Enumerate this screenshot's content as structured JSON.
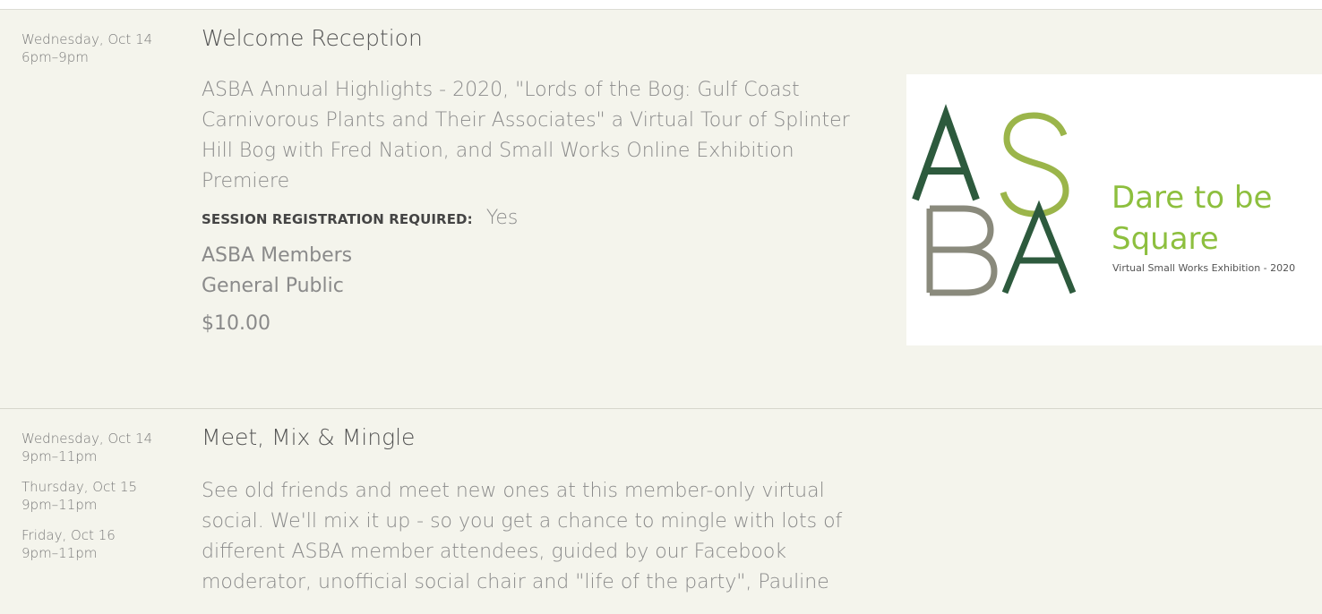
{
  "sessions": [
    {
      "dates": [
        {
          "day": "Wednesday, Oct 14",
          "time": "6pm–9pm"
        }
      ],
      "title": "Welcome Reception",
      "description": "ASBA Annual Highlights - 2020, \"Lords of the Bog: Gulf Coast Carnivorous Plants and Their Associates\" a Virtual Tour of Splinter Hill Bog with Fred Nation, and Small Works Online Exhibition Premiere",
      "registration_label": "SESSION REGISTRATION REQUIRED:",
      "registration_value": "Yes",
      "audience": [
        "ASBA Members",
        "General Public"
      ],
      "price": "$10.00",
      "image": {
        "logo_letters": [
          "A",
          "S",
          "B",
          "A"
        ],
        "headline": "Dare to be Square",
        "subtitle": "Virtual Small Works Exhibition - 2020",
        "colors": {
          "dark_green": "#2d5a3d",
          "light_green": "#9bb54a",
          "gray": "#8a8a7c",
          "headline": "#8dbf3e"
        }
      }
    },
    {
      "dates": [
        {
          "day": "Wednesday, Oct 14",
          "time": "9pm–11pm"
        },
        {
          "day": "Thursday, Oct 15",
          "time": "9pm–11pm"
        },
        {
          "day": "Friday, Oct 16",
          "time": "9pm–11pm"
        }
      ],
      "title": "Meet, Mix & Mingle",
      "description": "See old friends and meet new ones at this member-only virtual social. We'll mix it up - so you get a chance to mingle with lots of different ASBA member attendees, guided by our Facebook moderator, unofficial social chair and \"life of the party\", Pauline"
    }
  ],
  "colors": {
    "background": "#f4f4ec",
    "divider": "#d6d6cc",
    "text": "#8a8a8a"
  }
}
